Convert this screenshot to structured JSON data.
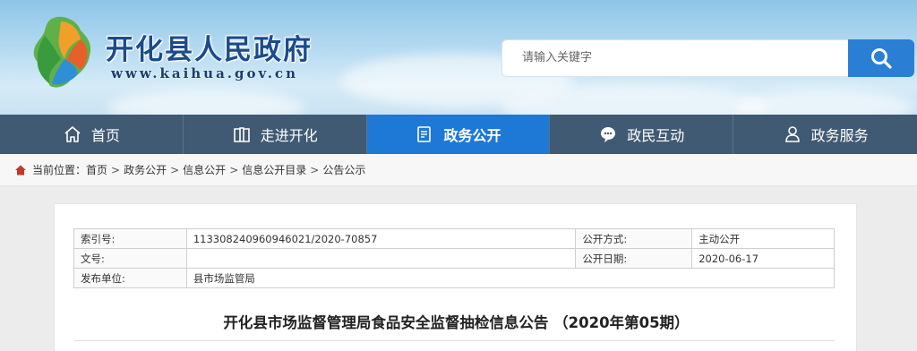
{
  "header": {
    "site_title": "开化县人民政府",
    "site_url": "www.kaihua.gov.cn",
    "search_placeholder": "请输入关键字"
  },
  "nav": [
    {
      "label": "首页",
      "icon": "home-icon"
    },
    {
      "label": "走进开化",
      "icon": "book-icon"
    },
    {
      "label": "政务公开",
      "icon": "document-icon",
      "active": true
    },
    {
      "label": "政民互动",
      "icon": "chat-icon"
    },
    {
      "label": "政务服务",
      "icon": "user-icon"
    }
  ],
  "breadcrumb": {
    "prefix": "当前位置：",
    "items": [
      "首页",
      "政务公开",
      "信息公开",
      "信息公开目录",
      "公告公示"
    ],
    "separator": ">"
  },
  "meta": {
    "index_label": "索引号:",
    "index_value": "113308240960946021/2020-70857",
    "disclosure_mode_label": "公开方式:",
    "disclosure_mode_value": "主动公开",
    "doc_no_label": "文号:",
    "doc_no_value": "",
    "disclosure_date_label": "公开日期:",
    "disclosure_date_value": "2020-06-17",
    "publisher_label": "发布单位:",
    "publisher_value": "县市场监管局"
  },
  "article": {
    "title": "开化县市场监督管理局食品安全监督抽检信息公告 （2020年第05期）"
  },
  "colors": {
    "nav_bg": "#415a73",
    "nav_active": "#1e78d6",
    "search_button": "#2a7fd4",
    "title_blue": "#1a4b8c"
  }
}
